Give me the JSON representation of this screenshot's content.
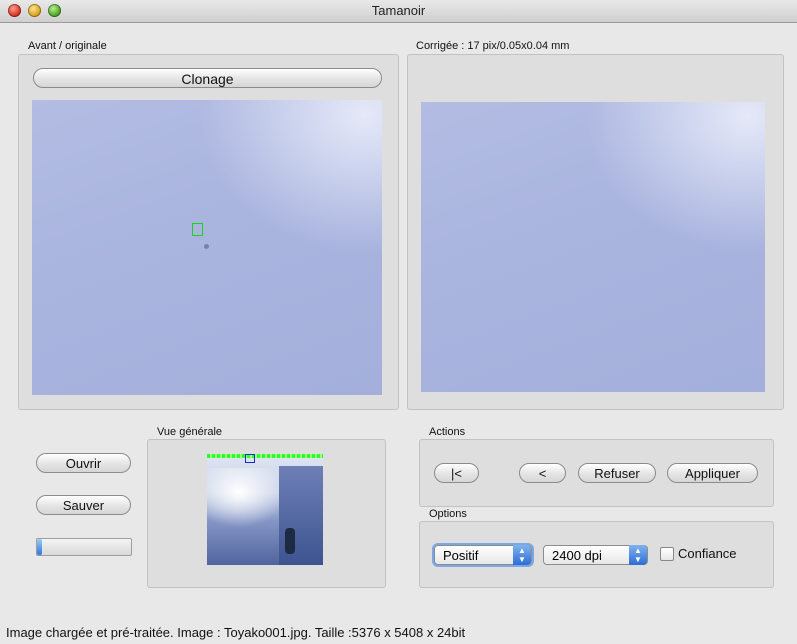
{
  "window": {
    "title": "Tamanoir"
  },
  "original": {
    "label": "Avant / originale",
    "clone_button": "Clonage"
  },
  "corrected": {
    "label": "Corrigée : 17 pix/0.05x0.04 mm"
  },
  "overview": {
    "label": "Vue générale"
  },
  "file_buttons": {
    "open": "Ouvrir",
    "save": "Sauver"
  },
  "progress": {
    "fraction": 0.05
  },
  "actions": {
    "label": "Actions",
    "first": "|<",
    "prev": "<",
    "refuse": "Refuser",
    "apply": "Appliquer"
  },
  "options": {
    "label": "Options",
    "mode": "Positif",
    "dpi": "2400 dpi",
    "confidence": "Confiance",
    "confidence_checked": false
  },
  "status": "Image chargée et pré-traitée. Image : Toyako001.jpg. Taille :5376 x 5408 x 24bit"
}
